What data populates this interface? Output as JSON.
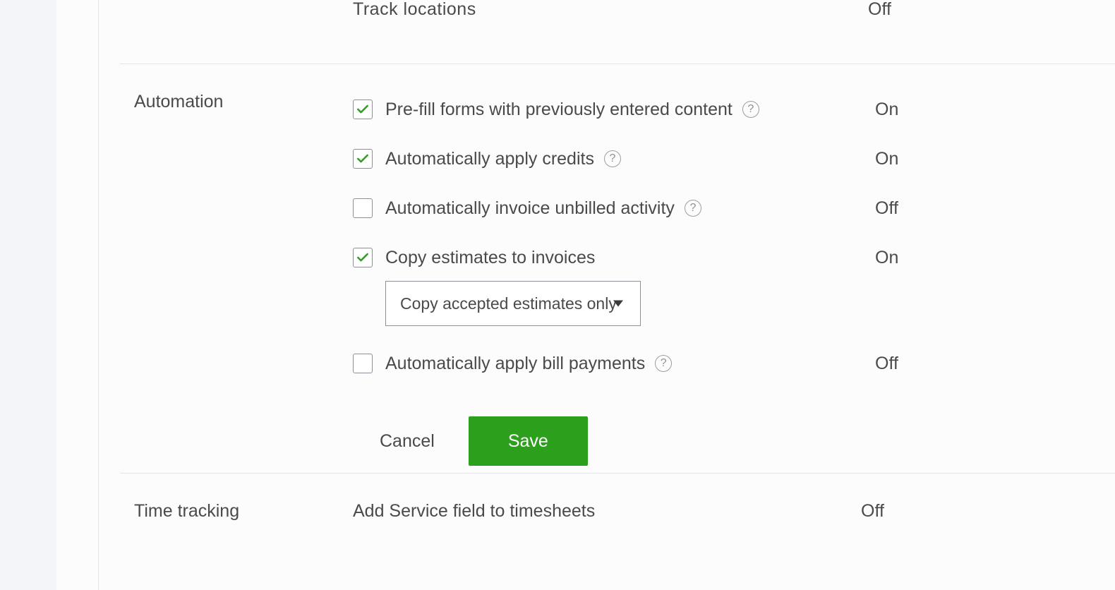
{
  "partial_top": {
    "label": "Track locations",
    "status": "Off"
  },
  "automation": {
    "title": "Automation",
    "rows": [
      {
        "label": "Pre-fill forms with previously entered content",
        "checked": true,
        "help": true,
        "status": "On"
      },
      {
        "label": "Automatically apply credits",
        "checked": true,
        "help": true,
        "status": "On"
      },
      {
        "label": "Automatically invoice unbilled activity",
        "checked": false,
        "help": true,
        "status": "Off"
      },
      {
        "label": "Copy estimates to invoices",
        "checked": true,
        "help": false,
        "status": "On"
      },
      {
        "label": "Automatically apply bill payments",
        "checked": false,
        "help": true,
        "status": "Off"
      }
    ],
    "select_value": "Copy accepted estimates only",
    "cancel_label": "Cancel",
    "save_label": "Save"
  },
  "time_tracking": {
    "title": "Time tracking",
    "label": "Add Service field to timesheets",
    "status": "Off"
  }
}
